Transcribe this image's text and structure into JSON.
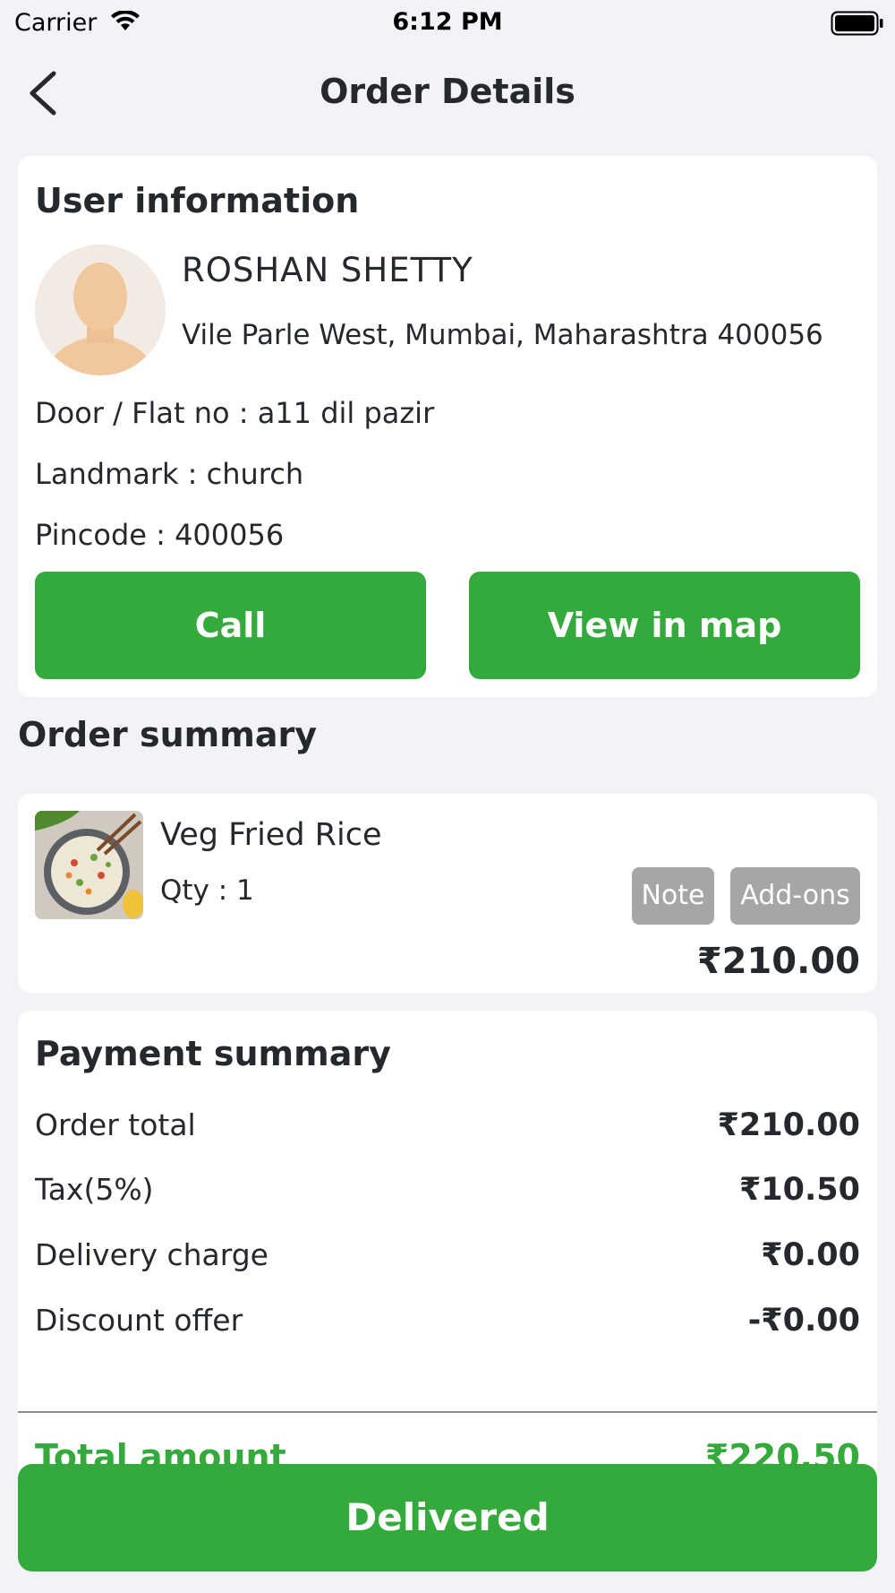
{
  "status_bar": {
    "carrier": "Carrier",
    "time": "6:12 PM"
  },
  "nav": {
    "title": "Order Details",
    "back_icon": "chevron-left-icon"
  },
  "user_info": {
    "section_title": "User information",
    "name": "ROSHAN SHETTY",
    "address": "Vile Parle West, Mumbai, Maharashtra 400056",
    "door_flat": "Door / Flat no : a11 dil pazir",
    "landmark": "Landmark : church",
    "pincode": "Pincode : 400056",
    "call_label": "Call",
    "map_label": "View in map"
  },
  "order_summary": {
    "section_title": "Order summary",
    "items": [
      {
        "name": "Veg Fried Rice",
        "qty": "Qty : 1",
        "note_label": "Note",
        "addons_label": "Add-ons",
        "price": "₹210.00"
      }
    ]
  },
  "payment_summary": {
    "section_title": "Payment summary",
    "rows": [
      {
        "label": "Order total",
        "value": "₹210.00"
      },
      {
        "label": "Tax(5%)",
        "value": "₹10.50"
      },
      {
        "label": "Delivery charge",
        "value": "₹0.00"
      },
      {
        "label": "Discount offer",
        "value": "-₹0.00"
      }
    ],
    "total_label": "Total amount",
    "total_value": "₹220.50"
  },
  "footer": {
    "delivered_label": "Delivered"
  },
  "colors": {
    "accent_green": "#35aa3c",
    "background": "#f2f2f7",
    "chip_gray": "#a6a6a6"
  }
}
